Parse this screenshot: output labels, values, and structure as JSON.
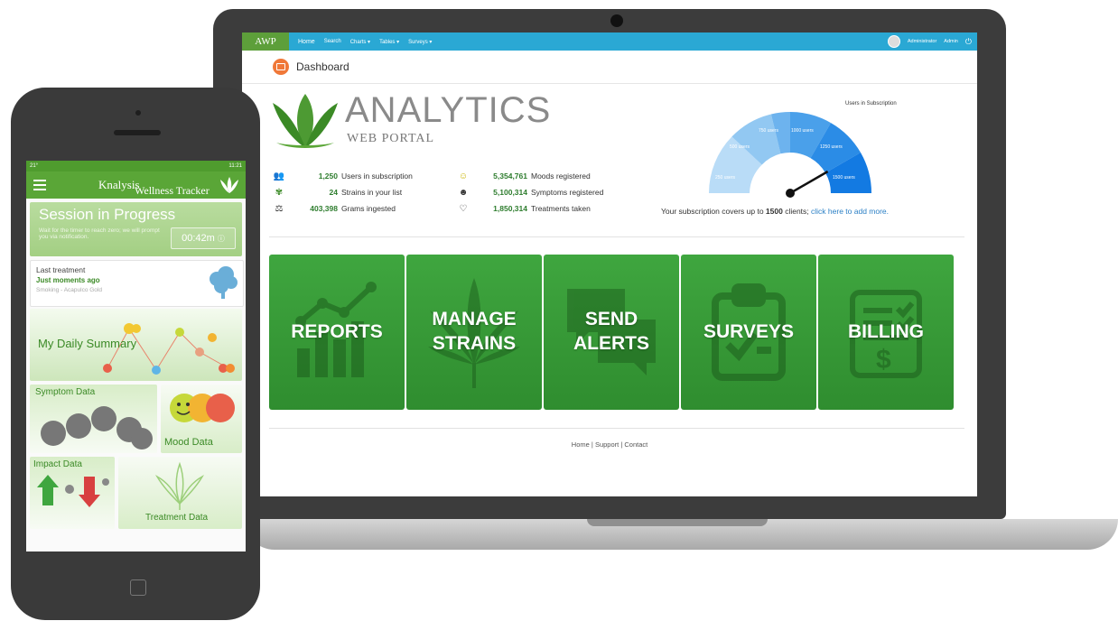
{
  "laptop": {
    "nav": {
      "logo": "AWP",
      "items": [
        "Home",
        "Search",
        "Charts ▾",
        "Tables ▾",
        "Surveys ▾"
      ],
      "user": "Administrator",
      "role": "Admin"
    },
    "page_title": "Dashboard",
    "brand": {
      "title": "ANALYTICS",
      "subtitle": "WEB PORTAL"
    },
    "stats_left": [
      {
        "icon": "users-icon",
        "value": "1,250",
        "label": "Users in subscription"
      },
      {
        "icon": "leaf-icon",
        "value": "24",
        "label": "Strains in your list"
      },
      {
        "icon": "scale-icon",
        "value": "403,398",
        "label": "Grams ingested"
      }
    ],
    "stats_right": [
      {
        "icon": "smiley-icon",
        "value": "5,354,761",
        "label": "Moods registered"
      },
      {
        "icon": "head-icon",
        "value": "5,100,314",
        "label": "Symptoms registered"
      },
      {
        "icon": "heartbeat-icon",
        "value": "1,850,314",
        "label": "Treatments taken"
      }
    ],
    "gauge": {
      "title": "Users in Subscription",
      "labels": [
        "250 users",
        "500 users",
        "750 users",
        "1000 users",
        "1250 users",
        "1500 users"
      ],
      "value": 1250,
      "max": 1500,
      "note_prefix": "Your subscription covers up to ",
      "note_count": "1500",
      "note_mid": " clients; ",
      "note_link": "click here to add more."
    },
    "tiles": [
      {
        "name": "reports",
        "label": "REPORTS"
      },
      {
        "name": "manage-strains",
        "label": "MANAGE\nSTRAINS"
      },
      {
        "name": "send-alerts",
        "label": "SEND\nALERTS"
      },
      {
        "name": "surveys",
        "label": "SURVEYS"
      },
      {
        "name": "billing",
        "label": "BILLING"
      }
    ],
    "footer": [
      "Home",
      "Support",
      "Contact"
    ]
  },
  "phone": {
    "status": {
      "left": "21°",
      "time": "11:21"
    },
    "app_title": "Knalysis",
    "app_subtitle": "Wellness Tracker",
    "session": {
      "title": "Session in Progress",
      "hint": "Wait for the timer to reach zero; we will prompt you via notification.",
      "timer": "00:42m"
    },
    "last_treatment": {
      "label": "Last treatment",
      "when": "Just moments ago",
      "detail": "Smoking - Acapulco Gold"
    },
    "cards": {
      "daily_summary": "My Daily Summary",
      "symptom_data": "Symptom Data",
      "mood_data": "Mood Data",
      "impact_data": "Impact Data",
      "treatment_data": "Treatment Data"
    },
    "colors": {
      "primary": "#5aa637",
      "accent": "#2e7d2e"
    }
  }
}
